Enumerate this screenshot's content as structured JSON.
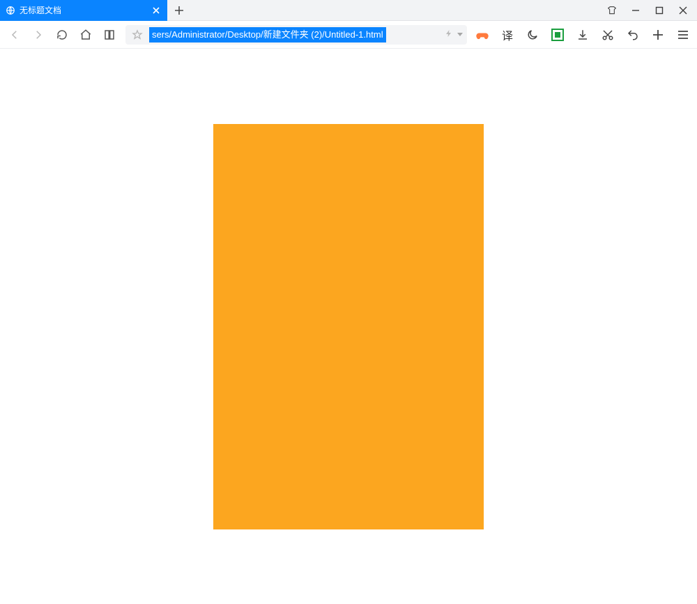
{
  "tab": {
    "title": "无标题文档",
    "icon": "globe-icon",
    "close_label": "×"
  },
  "address": {
    "selected_text": "sers/Administrator/Desktop/新建文件夹 (2)/Untitled-1.html"
  },
  "toolbar_right": {
    "translate_label": "译"
  },
  "colors": {
    "accent": "#0a84ff",
    "box": "#fca61f",
    "screenshot": "#1b9e3e",
    "gamepad": "#ff7a3d"
  }
}
